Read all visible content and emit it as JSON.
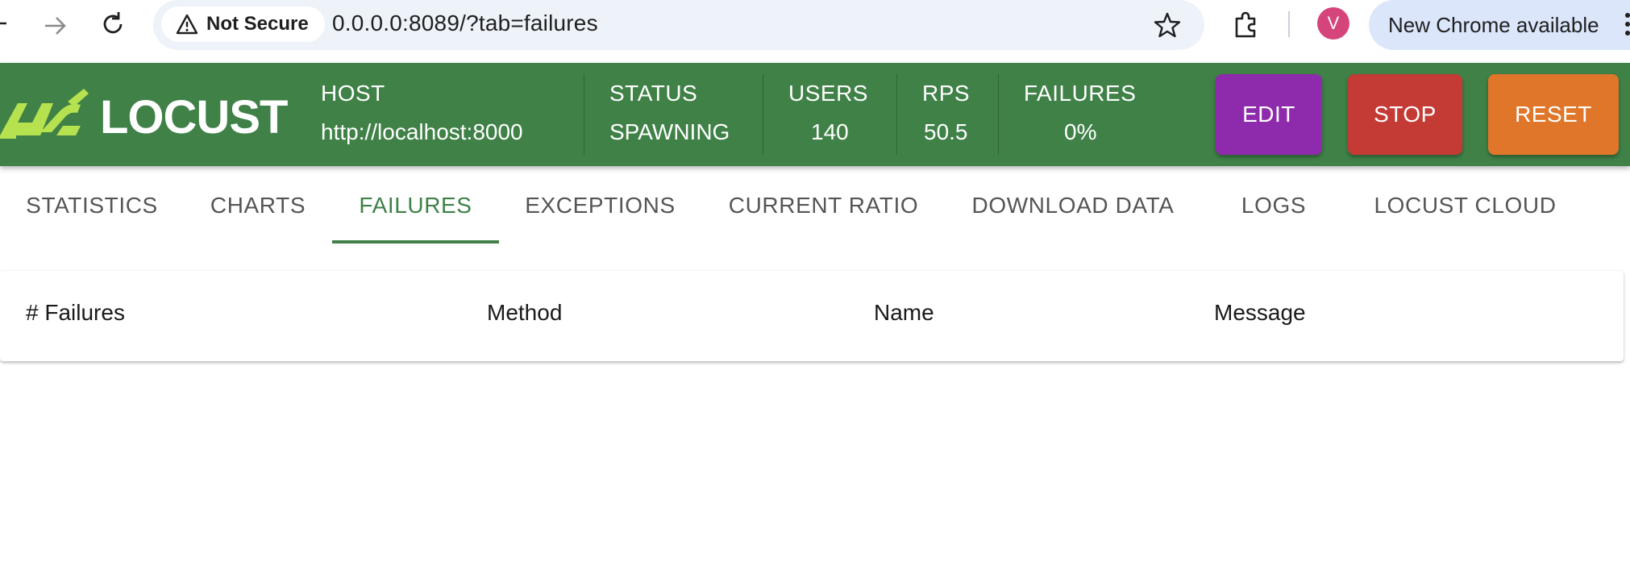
{
  "browser": {
    "security_label": "Not Secure",
    "url": "0.0.0.0:8089/?tab=failures",
    "profile_initial": "V",
    "update_label": "New Chrome available",
    "icons": [
      "back-arrow-icon",
      "forward-arrow-icon",
      "reload-icon",
      "warning-icon",
      "star-icon",
      "extensions-icon",
      "more-menu-icon"
    ]
  },
  "header": {
    "brand": "LOCUST",
    "stats": {
      "host": {
        "label": "HOST",
        "value": "http://localhost:8000"
      },
      "status": {
        "label": "STATUS",
        "value": "SPAWNING"
      },
      "users": {
        "label": "USERS",
        "value": "140"
      },
      "rps": {
        "label": "RPS",
        "value": "50.5"
      },
      "failures": {
        "label": "FAILURES",
        "value": "0%"
      }
    },
    "buttons": {
      "edit": "EDIT",
      "stop": "STOP",
      "reset": "RESET"
    },
    "colors": {
      "header_bg": "#3f8147",
      "edit": "#8e2bac",
      "stop": "#c43b36",
      "reset": "#e0762a",
      "logo_accent": "#b7e24f"
    }
  },
  "tabs": [
    {
      "label": "STATISTICS"
    },
    {
      "label": "CHARTS"
    },
    {
      "label": "FAILURES",
      "active": true
    },
    {
      "label": "EXCEPTIONS"
    },
    {
      "label": "CURRENT RATIO"
    },
    {
      "label": "DOWNLOAD DATA"
    },
    {
      "label": "LOGS"
    },
    {
      "label": "LOCUST CLOUD"
    }
  ],
  "failures_table": {
    "columns": [
      "# Failures",
      "Method",
      "Name",
      "Message"
    ],
    "rows": []
  }
}
